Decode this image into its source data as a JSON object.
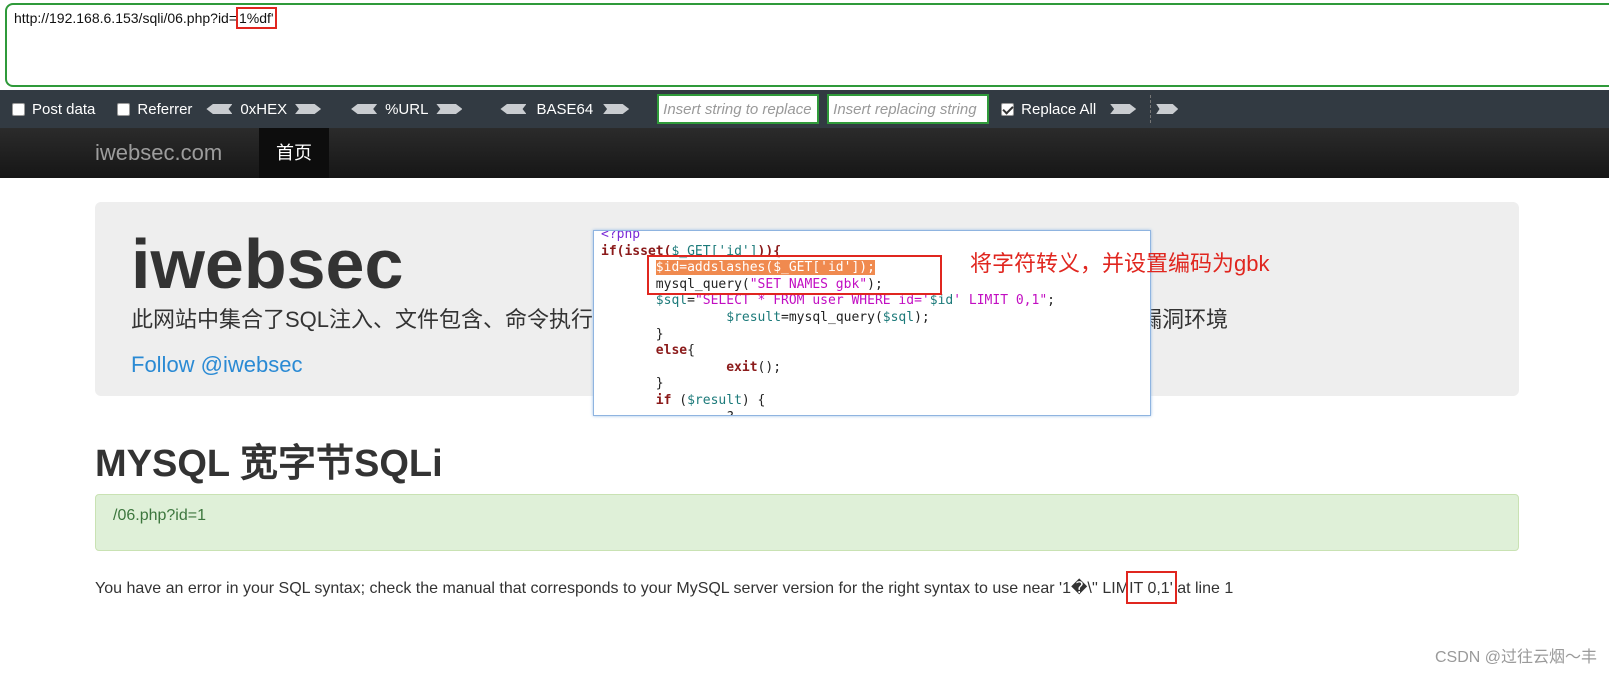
{
  "urlbar": {
    "url_prefix": "http://192.168.6.153/sqli/06.php?id=",
    "url_highlight": "1%df'"
  },
  "hackbar": {
    "post_data": "Post data",
    "referrer": "Referrer",
    "hex": "0xHEX",
    "url": "%URL",
    "base64": "BASE64",
    "find_placeholder": "Insert string to replace",
    "replace_placeholder": "Insert replacing string",
    "replace_all": "Replace All"
  },
  "nav": {
    "brand": "iwebsec.com",
    "home": "首页"
  },
  "jumbotron": {
    "title": "iwebsec",
    "desc_left": "此网站中集合了SQL注入、文件包含、命令执行",
    "desc_right": "漏洞环境",
    "follow": "Follow @iwebsec"
  },
  "page_title": "MYSQL 宽字节SQLi",
  "alert_text": "/06.php?id=1",
  "error": {
    "before": "You have an error in your SQL syntax; check the manual that corresponds to your MySQL server version for the right syntax to use near '",
    "near": "1�\\'",
    "after": "' LIMIT 0,1' at line 1"
  },
  "code": {
    "l1": "<?php",
    "l2_a": "if(isset(",
    "l2_b": "$_GET['id']",
    "l2_c": ")){",
    "l3": "$id=addslashes($_GET['id']);",
    "l4_a": "mysql_query(",
    "l4_b": "\"SET NAMES gbk\"",
    "l4_c": ");",
    "l5_a": "$sql",
    "l5_b": "=",
    "l5_c": "\"SELECT * FROM user WHERE id='",
    "l5_d": "$id",
    "l5_e": "' LIMIT 0,1\"",
    "l5_f": ";",
    "l6_a": "$result",
    "l6_b": "=mysql_query(",
    "l6_c": "$sql",
    "l6_d": ");",
    "l7": "}",
    "l8_a": "else",
    "l8_b": "{",
    "l9_a": "exit",
    "l9_b": "();",
    "l10": "}",
    "l11_a": "if",
    "l11_b": " (",
    "l11_c": "$result",
    "l11_d": ") {",
    "l12": "?"
  },
  "annotation": "将字符转义，并设置编码为gbk",
  "watermark": "CSDN @过往云烟～丰",
  "colors": {
    "annotation_red": "#e0261f",
    "hackbar_bg": "#323a42",
    "input_border": "#2f9a3a"
  }
}
